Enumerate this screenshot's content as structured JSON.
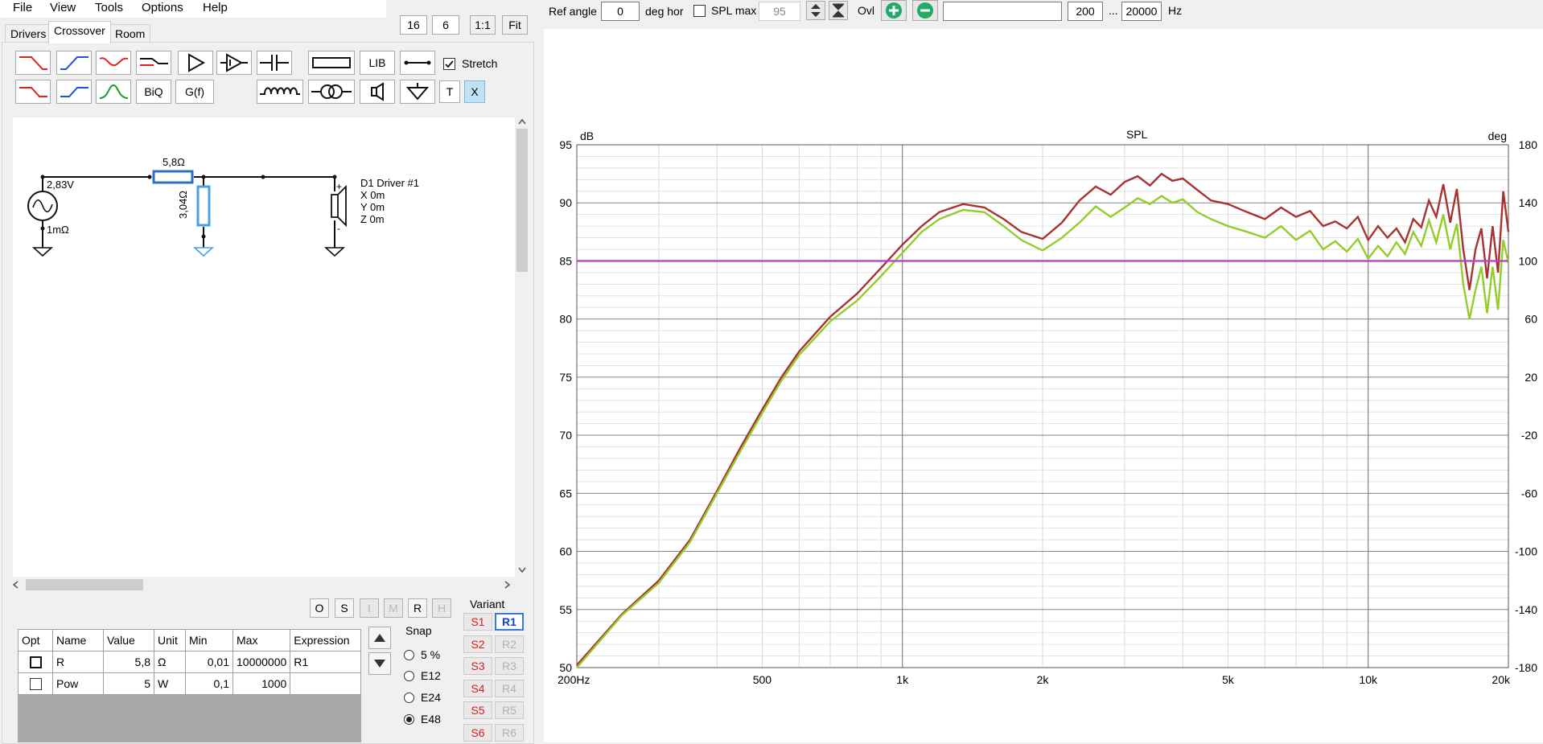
{
  "menu": [
    "File",
    "View",
    "Tools",
    "Options",
    "Help"
  ],
  "tabs": [
    "Drivers",
    "Crossover",
    "Room"
  ],
  "zoom": {
    "a": "16",
    "b": "6",
    "one_to_one": "1:1",
    "fit": "Fit"
  },
  "toolbar": {
    "lib": "LIB",
    "biq": "BiQ",
    "gf": "G(f)",
    "t": "T",
    "x": "X",
    "stretch": "Stretch",
    "stretch_checked": true
  },
  "schematic": {
    "source_voltage": "2,83V",
    "source_resistance": "1mΩ",
    "series_resistor": "5,8Ω",
    "shunt_resistor": "3,04Ω",
    "driver": {
      "name": "D1 Driver #1",
      "x": "X 0m",
      "y": "Y 0m",
      "z": "Z 0m",
      "plus": "+",
      "minus": "-"
    }
  },
  "flags": [
    "O",
    "S",
    "I",
    "M",
    "R",
    "H"
  ],
  "params": {
    "headers": [
      "Opt",
      "Name",
      "Value",
      "Unit",
      "Min",
      "Max",
      "Expression"
    ],
    "rows": [
      {
        "name": "R",
        "value": "5,8",
        "unit": "Ω",
        "min": "0,01",
        "max": "10000000",
        "expr": "R1"
      },
      {
        "name": "Pow",
        "value": "5",
        "unit": "W",
        "min": "0,1",
        "max": "1000",
        "expr": ""
      }
    ]
  },
  "snap": {
    "title": "Snap",
    "options": [
      "5 %",
      "E12",
      "E24",
      "E48"
    ],
    "selected": "E48"
  },
  "variant": {
    "title": "Variant",
    "s": [
      "S1",
      "S2",
      "S3",
      "S4",
      "S5",
      "S6"
    ],
    "r": [
      "R1",
      "R2",
      "R3",
      "R4",
      "R5",
      "R6"
    ],
    "active": "R1"
  },
  "topbar": {
    "ref_angle_label": "Ref angle",
    "ref_angle": "0",
    "deg_hor": "deg hor",
    "spl_max_label": "SPL max",
    "spl_max": "95",
    "ovl": "Ovl",
    "range_from": "200",
    "range_sep": "...",
    "range_to": "20000",
    "unit": "Hz"
  },
  "chart_data": {
    "type": "line",
    "title": "SPL",
    "ylabel_left": "dB",
    "ylabel_right": "deg",
    "x_scale": "log",
    "xlim": [
      200,
      20000
    ],
    "ylim": [
      50,
      95
    ],
    "ylim_right": [
      -180,
      180
    ],
    "x_tick_labels": [
      "200Hz",
      "500",
      "1k",
      "2k",
      "5k",
      "10k",
      "20k"
    ],
    "x_ticks": [
      200,
      500,
      1000,
      2000,
      5000,
      10000,
      20000
    ],
    "y_ticks": [
      50,
      55,
      60,
      65,
      70,
      75,
      80,
      85,
      90,
      95
    ],
    "y_ticks_right": [
      -180,
      -140,
      -100,
      -60,
      -20,
      20,
      60,
      100,
      140,
      180
    ],
    "grid": true,
    "colors": {
      "red": "#a83232",
      "green": "#94cc2a",
      "magenta": "#c040c8"
    },
    "series": [
      {
        "color": "#a83232",
        "x": [
          200,
          250,
          300,
          350,
          400,
          450,
          500,
          550,
          600,
          700,
          800,
          900,
          1000,
          1100,
          1200,
          1350,
          1500,
          1650,
          1800,
          2000,
          2200,
          2400,
          2600,
          2800,
          3000,
          3200,
          3400,
          3600,
          3800,
          4000,
          4300,
          4600,
          5000,
          5500,
          6000,
          6500,
          7000,
          7500,
          8000,
          8500,
          9000,
          9500,
          10000,
          10500,
          11000,
          11500,
          12000,
          12500,
          13000,
          13500,
          14000,
          14500,
          15000,
          15500,
          16000,
          16500,
          17000,
          17500,
          18000,
          18500,
          19000,
          19500,
          20000
        ],
        "y": [
          50.2,
          54.6,
          57.5,
          61.0,
          65.2,
          69.0,
          72.2,
          75.0,
          77.2,
          80.2,
          82.2,
          84.4,
          86.4,
          88.0,
          89.2,
          89.9,
          89.6,
          88.6,
          87.5,
          86.9,
          88.3,
          90.2,
          91.4,
          90.7,
          91.8,
          92.3,
          91.5,
          92.5,
          91.9,
          92.1,
          91.1,
          90.2,
          89.9,
          89.2,
          88.6,
          89.6,
          88.8,
          89.3,
          88.0,
          88.4,
          87.8,
          88.8,
          86.8,
          88.0,
          87.0,
          87.8,
          86.6,
          88.6,
          87.9,
          90.2,
          88.8,
          91.6,
          88.3,
          91.2,
          86.0,
          82.5,
          86.0,
          87.8,
          83.5,
          88.0,
          84.0,
          91.0,
          87.5
        ]
      },
      {
        "color": "#94cc2a",
        "x": [
          200,
          250,
          300,
          350,
          400,
          450,
          500,
          550,
          600,
          700,
          800,
          900,
          1000,
          1100,
          1200,
          1350,
          1500,
          1650,
          1800,
          2000,
          2200,
          2400,
          2600,
          2800,
          3000,
          3200,
          3400,
          3600,
          3800,
          4000,
          4300,
          4600,
          5000,
          5500,
          6000,
          6500,
          7000,
          7500,
          8000,
          8500,
          9000,
          9500,
          10000,
          10500,
          11000,
          11500,
          12000,
          12500,
          13000,
          13500,
          14000,
          14500,
          15000,
          15500,
          16000,
          16500,
          17000,
          17500,
          18000,
          18500,
          19000,
          19500,
          20000
        ],
        "y": [
          50.0,
          54.5,
          57.3,
          60.8,
          65.0,
          68.7,
          71.9,
          74.7,
          76.9,
          79.8,
          81.6,
          83.7,
          85.7,
          87.5,
          88.6,
          89.4,
          89.2,
          88.0,
          86.8,
          85.9,
          87.0,
          88.3,
          89.7,
          88.8,
          89.6,
          90.4,
          89.9,
          90.6,
          90.0,
          90.3,
          89.2,
          88.6,
          88.0,
          87.5,
          87.0,
          88.0,
          86.8,
          87.6,
          86.0,
          86.7,
          85.8,
          86.9,
          85.2,
          86.3,
          85.4,
          86.6,
          85.6,
          87.5,
          86.3,
          88.5,
          86.6,
          89.0,
          86.0,
          88.2,
          83.0,
          80.0,
          82.5,
          84.5,
          80.5,
          84.5,
          80.8,
          86.8,
          84.8
        ]
      },
      {
        "color": "#c040c8",
        "x": [
          200,
          20000
        ],
        "y": [
          85.0,
          85.0
        ]
      }
    ]
  }
}
